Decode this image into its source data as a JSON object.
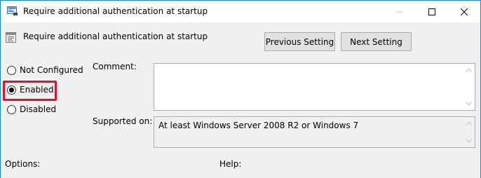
{
  "window": {
    "title": "Require additional authentication at startup",
    "controls": [
      "minimize",
      "maximize",
      "close"
    ]
  },
  "header": {
    "policy_name": "Require additional authentication at startup",
    "prev_button": "Previous Setting",
    "next_button": "Next Setting"
  },
  "state": {
    "options": [
      {
        "label": "Not Configured",
        "selected": false
      },
      {
        "label": "Enabled",
        "selected": true
      },
      {
        "label": "Disabled",
        "selected": false
      }
    ],
    "highlight_color": "#e8112d"
  },
  "fields": {
    "comment_label": "Comment:",
    "comment_value": "",
    "supported_label": "Supported on:",
    "supported_value": "At least Windows Server 2008 R2 or Windows 7"
  },
  "footer": {
    "options_label": "Options:",
    "help_label": "Help:"
  },
  "colors": {
    "title_border": "#1883d7",
    "button_bg": "#e1e1e1"
  }
}
